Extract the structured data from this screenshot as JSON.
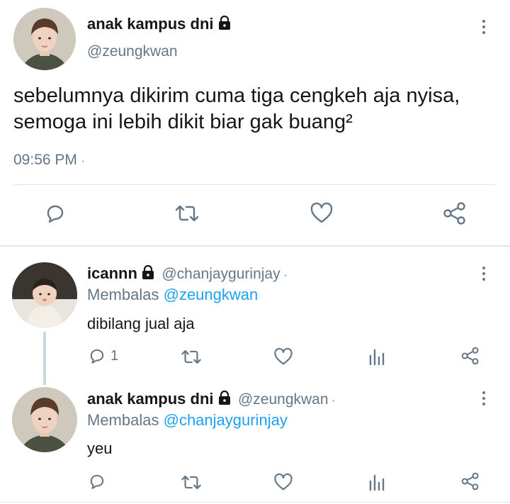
{
  "main_tweet": {
    "author_name": "anak kampus dni",
    "author_handle": "@zeungkwan",
    "text_line1": "sebelumnya dikirim cuma tiga cengkeh aja nyisa,",
    "text_line2": "semoga ini lebih dikit biar gak buang²",
    "time": "09:56 PM",
    "time_sep": "·",
    "icons": [
      "reply-icon",
      "retweet-icon",
      "like-icon",
      "share-icon"
    ]
  },
  "replies": [
    {
      "author_name": "icannn",
      "author_handle": "@chanjaygurinjay",
      "sep": "·",
      "replying_label": "Membalas",
      "replying_to": "@zeungkwan",
      "text": "dibilang jual aja",
      "reply_count": "1"
    },
    {
      "author_name": "anak kampus dni",
      "author_handle": "@zeungkwan",
      "sep": "·",
      "replying_label": "Membalas",
      "replying_to": "@chanjaygurinjay",
      "text": "yeu",
      "reply_count": ""
    }
  ],
  "colors": {
    "text": "#14171a",
    "muted": "#657786",
    "link": "#1da1f2",
    "divider": "#e1e8ed"
  }
}
